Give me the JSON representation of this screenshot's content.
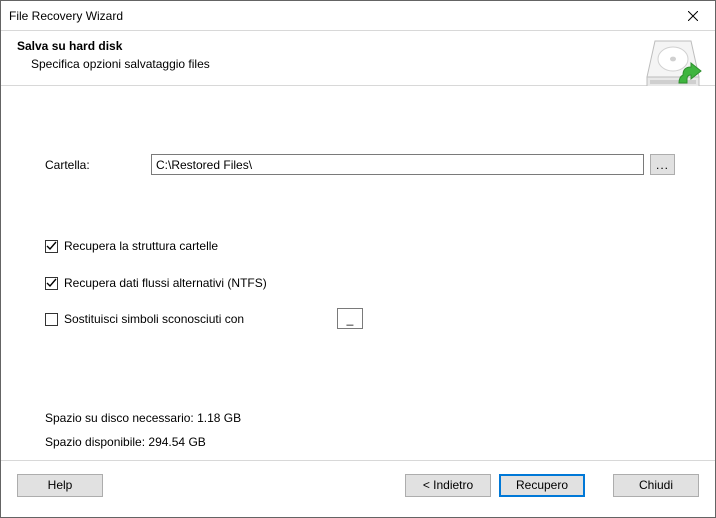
{
  "window": {
    "title": "File Recovery Wizard"
  },
  "header": {
    "title": "Salva su hard disk",
    "subtitle": "Specifica opzioni salvataggio files"
  },
  "form": {
    "folder_label": "Cartella:",
    "folder_value": "C:\\Restored Files\\",
    "browse_label": "...",
    "cb_structure": {
      "checked": true,
      "label": "Recupera la struttura cartelle"
    },
    "cb_ads": {
      "checked": true,
      "label": "Recupera dati flussi alternativi (NTFS)"
    },
    "cb_replace": {
      "checked": false,
      "label": "Sostituisci simboli sconosciuti con"
    },
    "replace_char": "_"
  },
  "disk": {
    "required": "Spazio su disco necessario: 1.18 GB",
    "available": "Spazio disponibile: 294.54 GB"
  },
  "footer": {
    "help": "Help",
    "back": "< Indietro",
    "recover": "Recupero",
    "close": "Chiudi"
  }
}
